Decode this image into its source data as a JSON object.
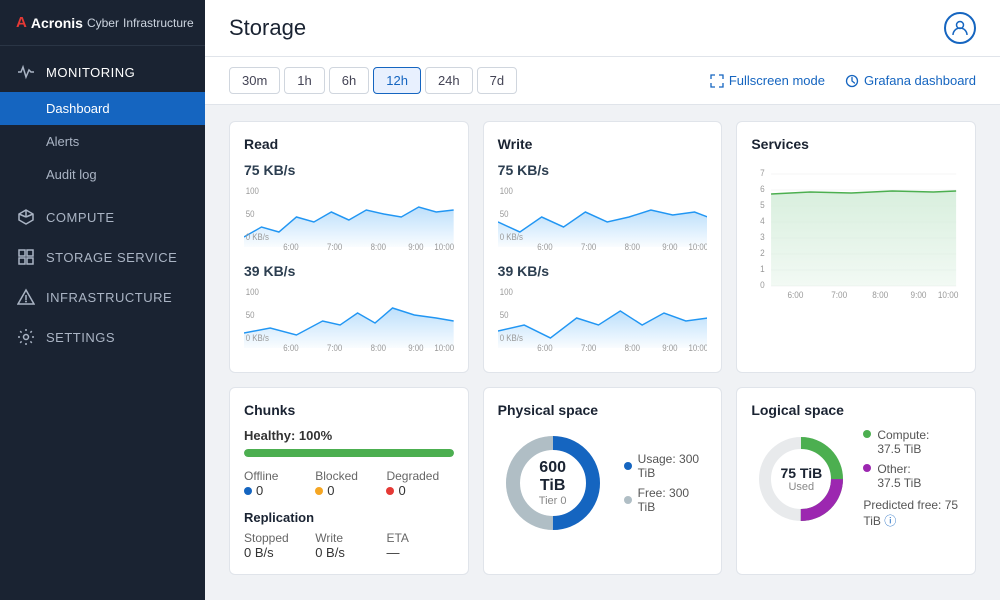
{
  "sidebar": {
    "logo": {
      "acronis": "Acronis",
      "cyber": "Cyber",
      "infrastructure": "Infrastructure"
    },
    "sections": [
      {
        "id": "monitoring",
        "label": "MONITORING",
        "icon": "pulse-icon",
        "sub": [
          "Dashboard",
          "Alerts",
          "Audit log"
        ]
      },
      {
        "id": "compute",
        "label": "COMPUTE",
        "icon": "cube-icon",
        "sub": []
      },
      {
        "id": "storage",
        "label": "STORAGE SERVICE",
        "icon": "grid-icon",
        "sub": []
      },
      {
        "id": "infrastructure",
        "label": "INFRASTRUCTURE",
        "icon": "triangle-icon",
        "sub": []
      },
      {
        "id": "settings",
        "label": "SETTINGS",
        "icon": "gear-icon",
        "sub": []
      }
    ]
  },
  "header": {
    "title": "Storage",
    "user_icon": "user-icon"
  },
  "toolbar": {
    "time_buttons": [
      "30m",
      "1h",
      "6h",
      "12h",
      "24h",
      "7d"
    ],
    "active_time": "12h",
    "fullscreen_label": "Fullscreen mode",
    "grafana_label": "Grafana dashboard"
  },
  "cards": {
    "read": {
      "title": "Read",
      "top_value": "75 KB/s",
      "bottom_value": "39 KB/s"
    },
    "write": {
      "title": "Write",
      "top_value": "75 KB/s",
      "bottom_value": "39 KB/s"
    },
    "services": {
      "title": "Services",
      "y_max": 7
    },
    "chunks": {
      "title": "Chunks",
      "healthy_label": "Healthy:",
      "healthy_value": "100%",
      "progress": 100,
      "offline_label": "Offline",
      "offline_value": "0",
      "blocked_label": "Blocked",
      "blocked_value": "0",
      "degraded_label": "Degraded",
      "degraded_value": "0",
      "replication_title": "Replication",
      "stopped_label": "Stopped",
      "stopped_value": "0 B/s",
      "write_label": "Write",
      "write_value": "0 B/s",
      "eta_label": "ETA",
      "eta_value": "—"
    },
    "physical": {
      "title": "Physical space",
      "main_value": "600 TiB",
      "sub_value": "Tier 0",
      "usage_label": "Usage:",
      "usage_value": "300 TiB",
      "free_label": "Free:",
      "free_value": "300 TiB"
    },
    "logical": {
      "title": "Logical space",
      "main_value": "75 TiB",
      "sub_value": "Used",
      "compute_label": "Compute:",
      "compute_value": "37.5 TiB",
      "other_label": "Other:",
      "other_value": "37.5 TiB",
      "predicted_label": "Predicted free:",
      "predicted_value": "75 TiB"
    }
  },
  "chart_x_labels": [
    "6:00",
    "7:00",
    "8:00",
    "9:00",
    "10:00"
  ]
}
